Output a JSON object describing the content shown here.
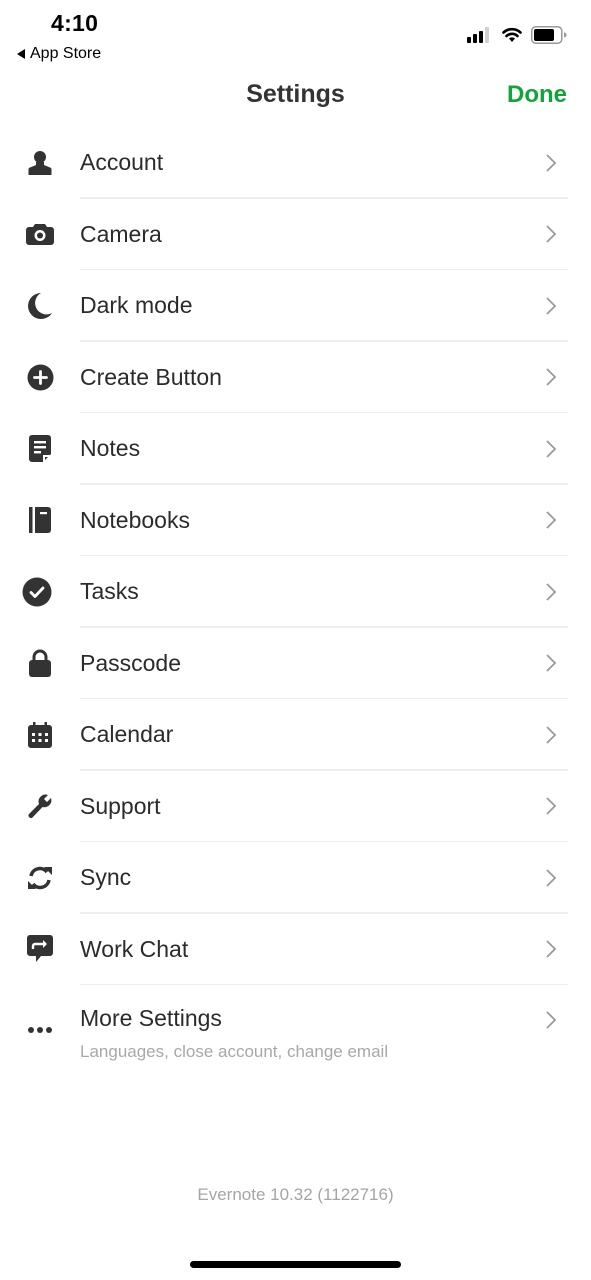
{
  "status_bar": {
    "time": "4:10",
    "back_app": "App Store",
    "signal_icon": "cellular-signal-icon",
    "wifi_icon": "wifi-icon",
    "battery_icon": "battery-icon"
  },
  "nav": {
    "title": "Settings",
    "done_label": "Done",
    "accent_color": "#14a33a"
  },
  "settings": {
    "items": [
      {
        "label": "Account",
        "icon": "person-icon"
      },
      {
        "label": "Camera",
        "icon": "camera-icon"
      },
      {
        "label": "Dark mode",
        "icon": "moon-icon"
      },
      {
        "label": "Create Button",
        "icon": "plus-circle-icon"
      },
      {
        "label": "Notes",
        "icon": "note-icon"
      },
      {
        "label": "Notebooks",
        "icon": "notebook-icon"
      },
      {
        "label": "Tasks",
        "icon": "check-circle-icon"
      },
      {
        "label": "Passcode",
        "icon": "lock-icon"
      },
      {
        "label": "Calendar",
        "icon": "calendar-icon"
      },
      {
        "label": "Support",
        "icon": "wrench-icon"
      },
      {
        "label": "Sync",
        "icon": "sync-icon"
      },
      {
        "label": "Work Chat",
        "icon": "work-chat-icon"
      }
    ],
    "more": {
      "label": "More Settings",
      "subtitle": "Languages, close account, change email",
      "icon": "more-dots-icon"
    }
  },
  "footer": {
    "version": "Evernote 10.32 (1122716)"
  }
}
